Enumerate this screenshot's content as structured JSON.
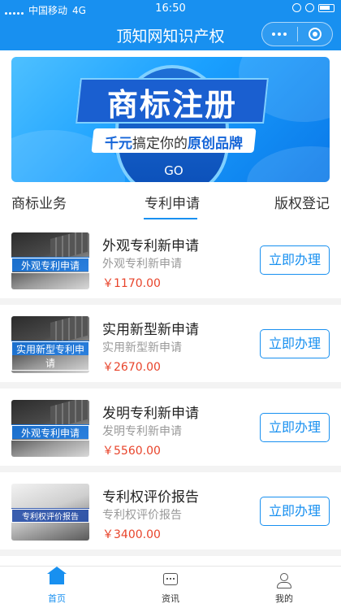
{
  "status_bar": {
    "carrier": "中国移动",
    "network": "4G",
    "time": "16:50"
  },
  "nav": {
    "title": "顶知网知识产权"
  },
  "banner": {
    "headline": "商标注册",
    "slogan_prefix": "千元",
    "slogan_middle": "搞定你的",
    "slogan_suffix": "原创品牌",
    "go_label": "GO"
  },
  "tabs": [
    {
      "label": "商标业务"
    },
    {
      "label": "专利申请"
    },
    {
      "label": "版权登记"
    }
  ],
  "active_tab": "专利申请",
  "items": [
    {
      "thumb_label": "外观专利申请",
      "name": "外观专利新申请",
      "sub": "外观专利新申请",
      "price": "￥1170.00",
      "button": "立即办理"
    },
    {
      "thumb_label": "实用新型专利申请",
      "name": "实用新型新申请",
      "sub": "实用新型新申请",
      "price": "￥2670.00",
      "button": "立即办理"
    },
    {
      "thumb_label": "外观专利申请",
      "name": "发明专利新申请",
      "sub": "发明专利新申请",
      "price": "￥5560.00",
      "button": "立即办理"
    },
    {
      "thumb_label": "专利权评价报告",
      "name": "专利权评价报告",
      "sub": "专利权评价报告",
      "price": "￥3400.00",
      "button": "立即办理"
    }
  ],
  "tabbar": [
    {
      "label": "首页",
      "icon": "home-icon"
    },
    {
      "label": "资讯",
      "icon": "news-icon"
    },
    {
      "label": "我的",
      "icon": "profile-icon"
    }
  ],
  "colors": {
    "primary": "#1890f0",
    "price": "#e8442b"
  }
}
